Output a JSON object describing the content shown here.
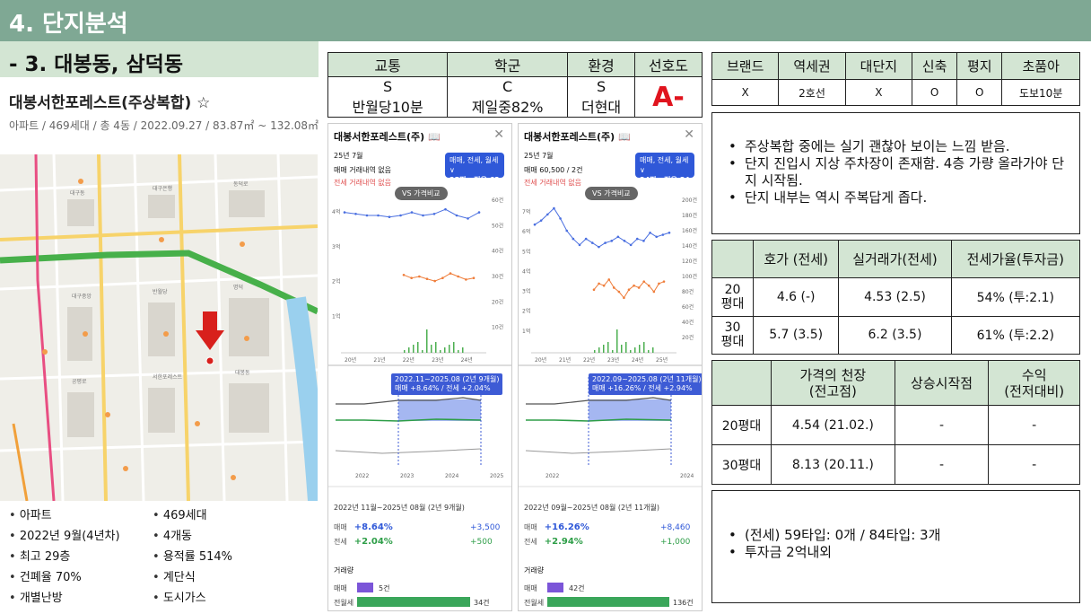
{
  "header": {
    "title": "4. 단지분석",
    "subtitle": "- 3. 대봉동, 삼덕동"
  },
  "apt": {
    "title": "대봉서한포레스트(주상복합) ☆",
    "info": "아파트 / 469세대 / 총 4동 / 2022.09.27 / 83.87㎡ ~ 132.08㎡"
  },
  "facts": [
    "아파트",
    "469세대",
    "2022년 9월(4년차)",
    "4개동",
    "최고 29층",
    "용적률 514%",
    "건폐율 70%",
    "계단식",
    "개별난방",
    "도시가스"
  ],
  "map": {
    "marker_icon": "arrow-down-icon",
    "accent": "#dd2020",
    "line_colors": [
      "#47b04a",
      "#e84e82",
      "#f1a03a"
    ]
  },
  "location_table": {
    "headers": [
      "교통",
      "학군",
      "환경",
      "선호도"
    ],
    "grades": [
      "S",
      "C",
      "S"
    ],
    "details": [
      "반월당10분",
      "제일중82%",
      "더현대"
    ],
    "preference": "A-"
  },
  "brand_table": {
    "headers": [
      "브랜드",
      "역세권",
      "대단지",
      "신축",
      "평지",
      "초품아"
    ],
    "values": [
      "X",
      "2호선",
      "X",
      "O",
      "O",
      "도보10분"
    ]
  },
  "note1": [
    "주상복합 중에는 실기 괜찮아 보이는 느낌 받음.",
    "단지 진입시 지상 주차장이 존재함. 4층 가량 올라가야 단지 시작됨.",
    "단지 내부는 역시 주복답게 좁다."
  ],
  "price_table": {
    "headers": [
      "",
      "호가 (전세)",
      "실거래가(전세)",
      "전세가율(투자금)"
    ],
    "rows": [
      {
        "label": "20\n평대",
        "ask": "4.6 (-)",
        "deal": "4.53 (2.5)",
        "ratio": "54% (투:2.1)"
      },
      {
        "label": "30\n평대",
        "ask": "5.7 (3.5)",
        "deal": "6.2 (3.5)",
        "ratio": "61% (투:2.2)"
      }
    ]
  },
  "peak_table": {
    "headers": [
      "",
      "가격의 천장\n(전고점)",
      "상승시작점",
      "수익\n(전저대비)"
    ],
    "rows": [
      {
        "label": "20평대",
        "peak": "4.54 (21.02.)",
        "start": "-",
        "profit": "-"
      },
      {
        "label": "30평대",
        "peak": "8.13 (20.11.)",
        "start": "-",
        "profit": "-"
      }
    ]
  },
  "note2": [
    "(전세) 59타입: 0개 / 84타입: 3개",
    "투자금 2억내외"
  ],
  "shots": [
    {
      "title": "대봉서한포레스트(주) 📖",
      "month": "25년 7월",
      "line1": "매매 거래내역 없음",
      "line2": "전세 거래내역 없음",
      "filter": "매매, 전세, 월세 ∨",
      "size": "25평 · 전용 62㎡",
      "vs": "VS 가격비교",
      "y_left": [
        "4억",
        "3억",
        "2억",
        "1억"
      ],
      "y_right": [
        "60건",
        "50건",
        "40건",
        "30건",
        "20건",
        "10건"
      ],
      "x_labels": [
        "20년",
        "21년",
        "22년",
        "23년",
        "24년"
      ],
      "tip": "2022.11~2025.08 (2년 9개월)",
      "tip2": "매매 +8.64% / 전세 +2.04%",
      "x2_labels": [
        "2022",
        "2023",
        "2024",
        "2025"
      ],
      "period": "2022년 11월~2025년 08월 (2년 9개월)",
      "sale_label": "매매",
      "sale_pct": "+8.64%",
      "sale_diff": "+3,500",
      "jeonse_label": "전세",
      "jeonse_pct": "+2.04%",
      "jeonse_diff": "+500",
      "vol_label": "거래량",
      "vol_sale": "5건",
      "vol_jeonse": "34건",
      "chart_data": {
        "type": "line",
        "series": [
          {
            "name": "매매",
            "values": [
              4.6,
              4.55,
              4.5,
              4.5,
              4.45,
              4.5,
              4.6,
              4.5,
              4.55,
              4.7,
              4.5,
              4.4,
              4.6
            ]
          },
          {
            "name": "전세",
            "values": [
              2.55,
              2.45,
              2.5,
              2.42,
              2.35,
              2.45,
              2.6,
              2.5,
              2.4,
              2.45
            ]
          }
        ],
        "ylim": [
          0,
          5
        ]
      }
    },
    {
      "title": "대봉서한포레스트(주) 📖",
      "month": "25년 7월",
      "line1": "매매 60,500 / 2건",
      "line2": "전세 거래내역 없음",
      "filter": "매매, 전세, 월세 ∨",
      "size": "34평 · 전용 84㎡",
      "vs": "VS 가격비교",
      "y_left": [
        "7억",
        "6억",
        "5억",
        "4억",
        "3억",
        "2억",
        "1억"
      ],
      "y_right": [
        "200건",
        "180건",
        "160건",
        "140건",
        "120건",
        "100건",
        "80건",
        "60건",
        "40건",
        "20건"
      ],
      "x_labels": [
        "20년",
        "21년",
        "22년",
        "23년",
        "24년",
        "25년"
      ],
      "tip": "2022.09~2025.08 (2년 11개월)",
      "tip2": "매매 +16.26% / 전세 +2.94%",
      "x2_labels": [
        "2022",
        "2024"
      ],
      "period": "2022년 09월~2025년 08월 (2년 11개월)",
      "sale_label": "매매",
      "sale_pct": "+16.26%",
      "sale_diff": "+8,460",
      "jeonse_label": "전세",
      "jeonse_pct": "+2.94%",
      "jeonse_diff": "+1,000",
      "vol_label": "거래량",
      "vol_sale": "42건",
      "vol_jeonse": "136건",
      "chart_data": {
        "type": "line",
        "series": [
          {
            "name": "매매",
            "values": [
              6.3,
              6.5,
              6.8,
              7.1,
              6.6,
              6.0,
              5.6,
              5.3,
              5.6,
              5.4,
              5.2,
              5.4,
              5.5,
              5.7,
              5.5,
              5.3,
              5.6,
              5.5,
              5.9,
              5.7,
              5.8,
              5.9
            ]
          },
          {
            "name": "전세",
            "values": [
              3.1,
              3.4,
              3.3,
              3.6,
              3.2,
              3.0,
              2.7,
              3.1,
              3.3,
              3.2,
              3.5,
              3.3,
              3.0,
              3.4,
              3.5
            ]
          }
        ],
        "ylim": [
          0,
          7.5
        ]
      }
    }
  ]
}
